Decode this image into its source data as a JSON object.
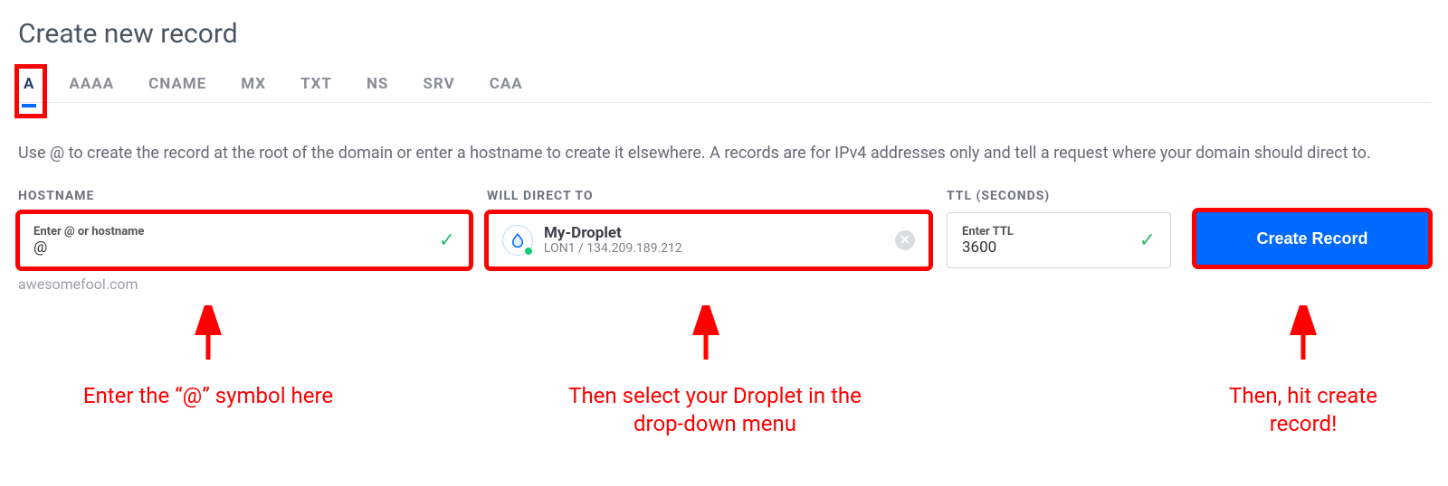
{
  "title": "Create new record",
  "tabs": [
    "A",
    "AAAA",
    "CNAME",
    "MX",
    "TXT",
    "NS",
    "SRV",
    "CAA"
  ],
  "active_tab_index": 0,
  "description": "Use @ to create the record at the root of the domain or enter a hostname to create it elsewhere. A records are for IPv4 addresses only and tell a request where your domain should direct to.",
  "hostname": {
    "label": "HOSTNAME",
    "placeholder": "Enter @ or hostname",
    "value": "@",
    "helper": "awesomefool.com"
  },
  "direct_to": {
    "label": "WILL DIRECT TO",
    "droplet_name": "My-Droplet",
    "droplet_sub": "LON1 / 134.209.189.212"
  },
  "ttl": {
    "label": "TTL (SECONDS)",
    "placeholder": "Enter TTL",
    "value": "3600"
  },
  "create_button": "Create Record",
  "annotations": {
    "hostname": "Enter the “@” symbol here",
    "direct": "Then select your Droplet in the\ndrop-down menu",
    "button": "Then, hit create\nrecord!"
  },
  "colors": {
    "accent": "#0069ff",
    "highlight": "red",
    "success": "#15cd72"
  }
}
